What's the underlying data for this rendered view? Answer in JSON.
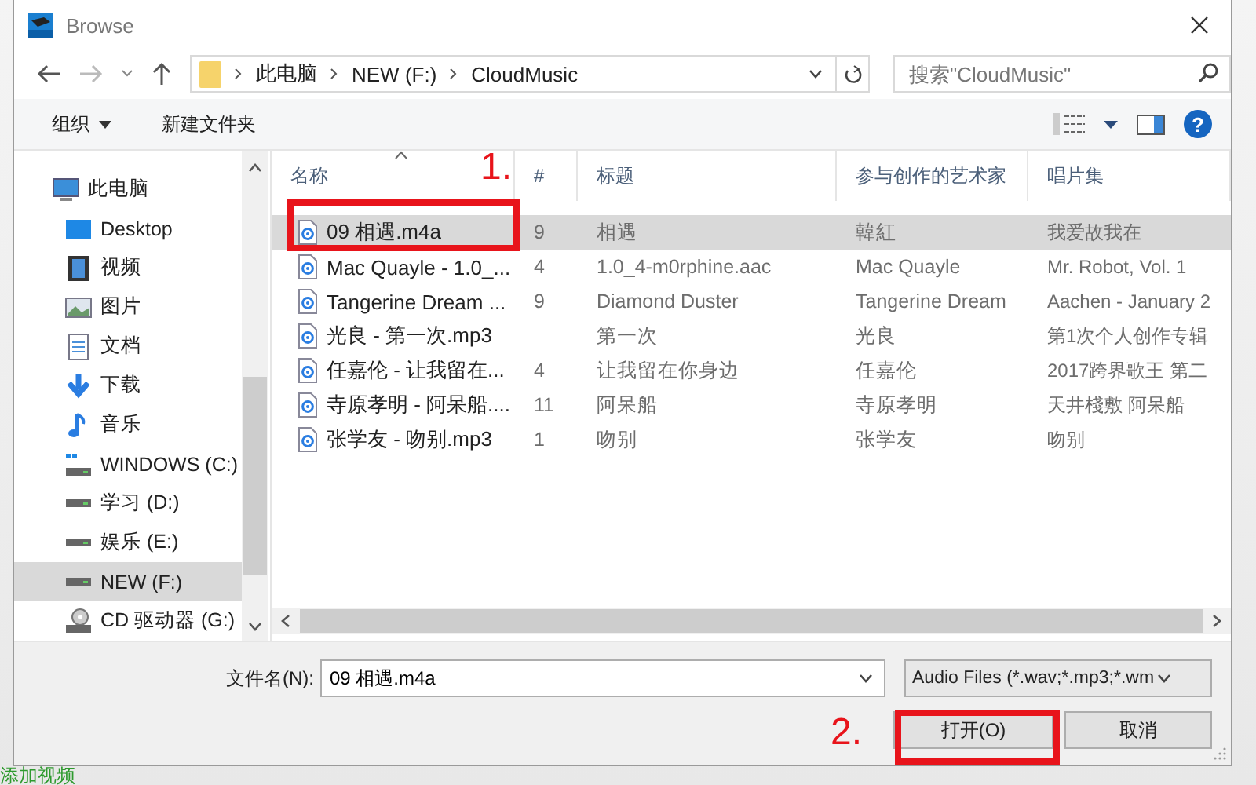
{
  "window": {
    "title": "Browse"
  },
  "address": {
    "crumbs": [
      "此电脑",
      "NEW (F:)",
      "CloudMusic"
    ]
  },
  "search": {
    "placeholder": "搜索\"CloudMusic\""
  },
  "toolbar": {
    "organize": "组织",
    "new_folder": "新建文件夹",
    "help": "?"
  },
  "sidebar": {
    "items": [
      {
        "label": "此电脑",
        "kind": "pc",
        "selected": false
      },
      {
        "label": "Desktop",
        "kind": "desktop",
        "selected": false
      },
      {
        "label": "视频",
        "kind": "video",
        "selected": false
      },
      {
        "label": "图片",
        "kind": "picture",
        "selected": false
      },
      {
        "label": "文档",
        "kind": "document",
        "selected": false
      },
      {
        "label": "下载",
        "kind": "download",
        "selected": false
      },
      {
        "label": "音乐",
        "kind": "music",
        "selected": false
      },
      {
        "label": "WINDOWS (C:)",
        "kind": "sysdrive",
        "selected": false
      },
      {
        "label": "学习 (D:)",
        "kind": "drive",
        "selected": false
      },
      {
        "label": "娱乐 (E:)",
        "kind": "drive",
        "selected": false
      },
      {
        "label": "NEW (F:)",
        "kind": "drive",
        "selected": true
      },
      {
        "label": "CD 驱动器 (G:)",
        "kind": "cd",
        "selected": false
      }
    ]
  },
  "table": {
    "columns": [
      "名称",
      "#",
      "标题",
      "参与创作的艺术家",
      "唱片集"
    ],
    "rows": [
      {
        "name": "09 相遇.m4a",
        "track": "9",
        "title": "相遇",
        "artist": "韓紅",
        "album": "我爱故我在",
        "selected": true
      },
      {
        "name": "Mac Quayle - 1.0_...",
        "track": "4",
        "title": "1.0_4-m0rphine.aac",
        "artist": "Mac Quayle",
        "album": "Mr. Robot, Vol. 1",
        "selected": false
      },
      {
        "name": "Tangerine Dream ...",
        "track": "9",
        "title": "Diamond Duster",
        "artist": "Tangerine Dream",
        "album": "Aachen - January 2",
        "selected": false
      },
      {
        "name": "光良 - 第一次.mp3",
        "title": "第一次",
        "artist": "光良",
        "album": "第1次个人创作专辑",
        "selected": false
      },
      {
        "name": "任嘉伦 - 让我留在...",
        "track": "4",
        "title": "让我留在你身边",
        "artist": "任嘉伦",
        "album": "2017跨界歌王 第二",
        "selected": false
      },
      {
        "name": "寺原孝明 - 阿呆船....",
        "track": "11",
        "title": "阿呆船",
        "artist": "寺原孝明",
        "album": "天井棧敷 阿呆船",
        "selected": false
      },
      {
        "name": "张学友 - 吻别.mp3",
        "track": "1",
        "title": "吻别",
        "artist": "张学友",
        "album": "吻别",
        "selected": false
      }
    ]
  },
  "filename": {
    "label": "文件名(N):",
    "value": "09 相遇.m4a"
  },
  "filter": {
    "value": "Audio Files (*.wav;*.mp3;*.wm"
  },
  "buttons": [
    "打开(O)",
    "取消"
  ],
  "annotations": [
    {
      "text": "1."
    },
    {
      "text": "2."
    }
  ],
  "background": {
    "text": "添加视频"
  }
}
